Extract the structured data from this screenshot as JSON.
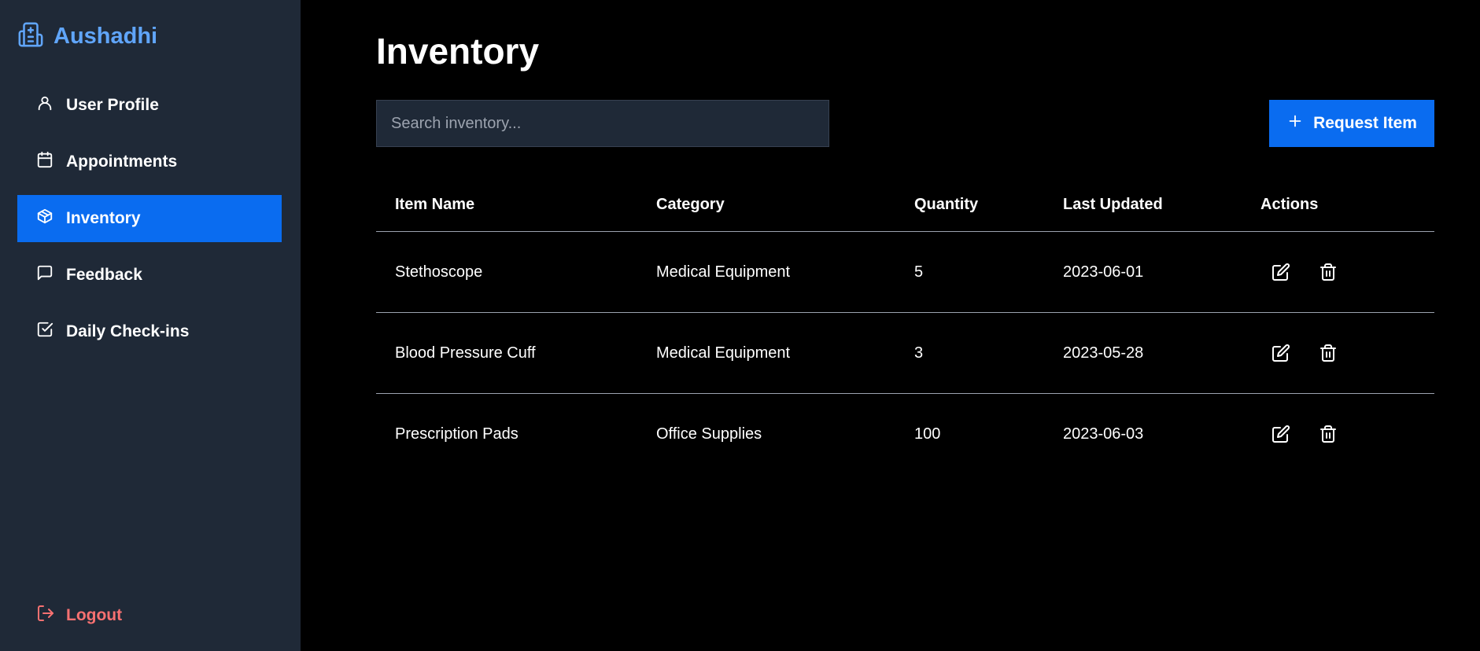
{
  "brand": {
    "name": "Aushadhi",
    "icon": "hospital-icon",
    "color": "#60a5fa"
  },
  "sidebar": {
    "items": [
      {
        "label": "User Profile",
        "icon": "user-icon",
        "active": false
      },
      {
        "label": "Appointments",
        "icon": "calendar-icon",
        "active": false
      },
      {
        "label": "Inventory",
        "icon": "package-icon",
        "active": true
      },
      {
        "label": "Feedback",
        "icon": "message-icon",
        "active": false
      },
      {
        "label": "Daily Check-ins",
        "icon": "check-square-icon",
        "active": false
      }
    ],
    "logout": {
      "label": "Logout",
      "icon": "logout-icon",
      "color": "#f87171"
    }
  },
  "main": {
    "title": "Inventory",
    "search": {
      "placeholder": "Search inventory...",
      "value": ""
    },
    "request_button": {
      "label": "Request Item",
      "icon": "plus-icon"
    },
    "table": {
      "headers": [
        "Item Name",
        "Category",
        "Quantity",
        "Last Updated",
        "Actions"
      ],
      "rows": [
        {
          "name": "Stethoscope",
          "category": "Medical Equipment",
          "quantity": "5",
          "last_updated": "2023-06-01"
        },
        {
          "name": "Blood Pressure Cuff",
          "category": "Medical Equipment",
          "quantity": "3",
          "last_updated": "2023-05-28"
        },
        {
          "name": "Prescription Pads",
          "category": "Office Supplies",
          "quantity": "100",
          "last_updated": "2023-06-03"
        }
      ],
      "row_action_icons": [
        "edit-icon",
        "trash-icon"
      ]
    }
  },
  "colors": {
    "accent": "#0a6cf0",
    "sidebar_bg": "#1f2937",
    "main_bg": "#000000"
  }
}
